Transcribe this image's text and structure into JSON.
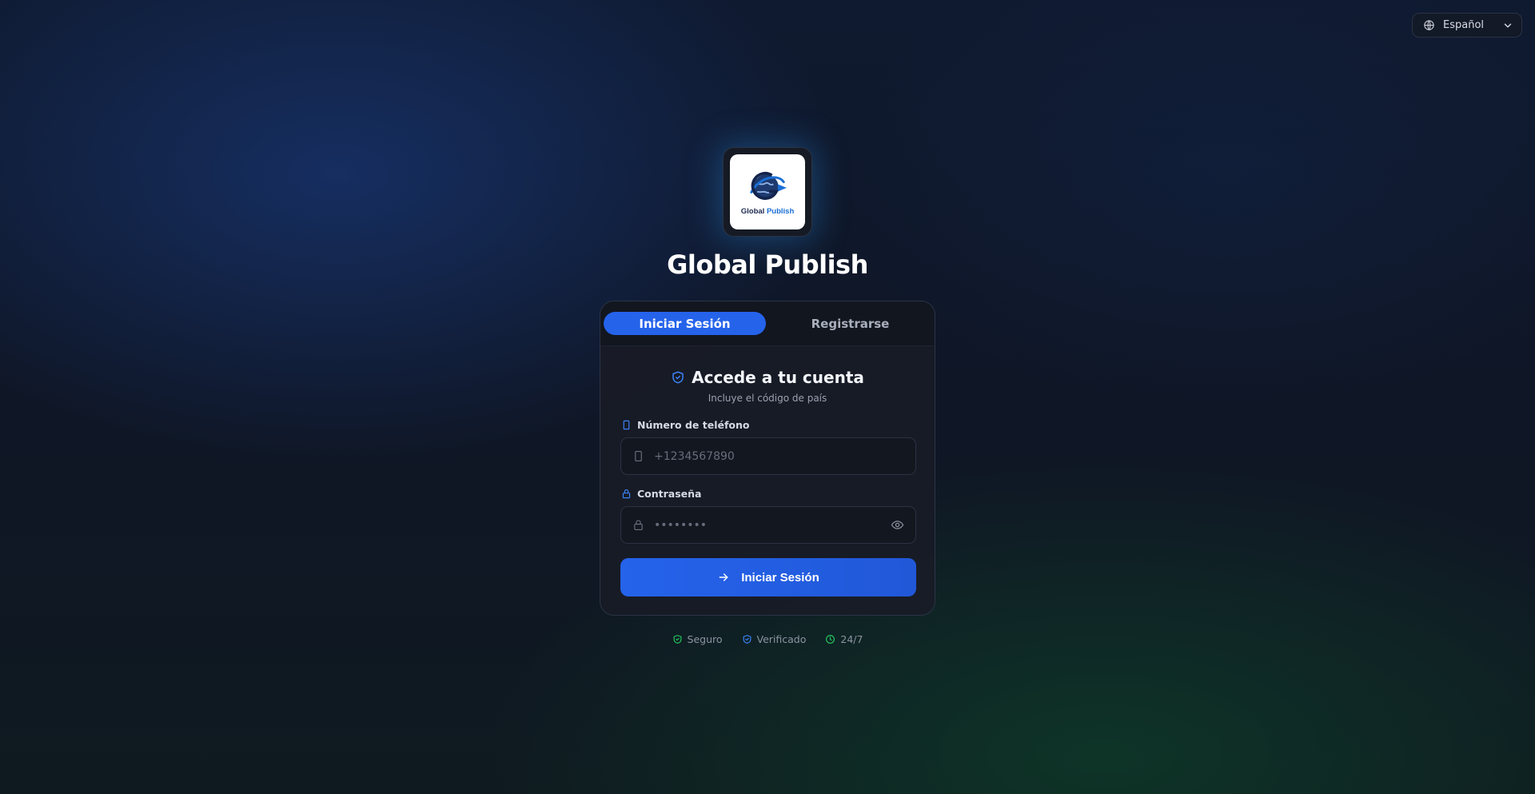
{
  "language": {
    "selected": "Español",
    "icon": "globe-icon"
  },
  "brand": {
    "logo_text_a": "Global",
    "logo_text_b": "Publish",
    "title": "Global Publish"
  },
  "tabs": [
    {
      "label": "Iniciar Sesión",
      "active": true
    },
    {
      "label": "Registrarse",
      "active": false
    }
  ],
  "form": {
    "heading": "Accede a tu cuenta",
    "subtitle": "Incluye el código de país",
    "phone": {
      "label": "Número de teléfono",
      "placeholder": "+1234567890",
      "value": ""
    },
    "password": {
      "label": "Contraseña",
      "placeholder": "••••••••",
      "value": ""
    },
    "submit_label": "Iniciar Sesión"
  },
  "badges": [
    {
      "label": "Seguro",
      "icon": "shield-check-icon",
      "color": "#22c55e"
    },
    {
      "label": "Verificado",
      "icon": "shield-check-icon",
      "color": "#3b82f6"
    },
    {
      "label": "24/7",
      "icon": "clock-icon",
      "color": "#22c55e"
    }
  ],
  "colors": {
    "accent": "#2563eb",
    "success": "#22c55e"
  }
}
